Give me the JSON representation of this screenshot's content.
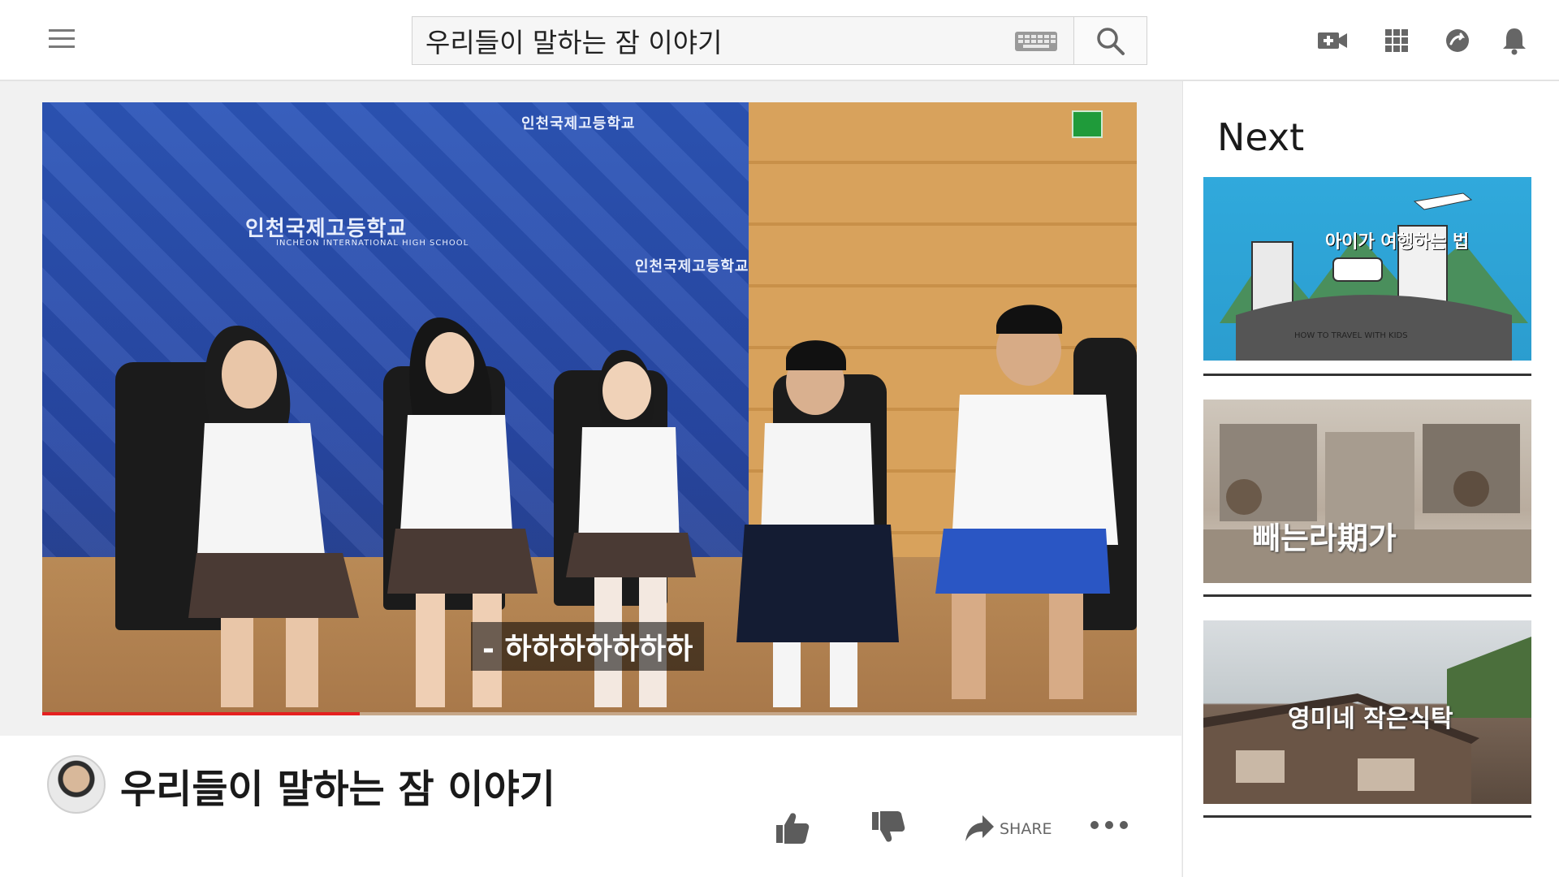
{
  "search": {
    "value": "우리들이 말하는 잠 이야기"
  },
  "header": {
    "icons": [
      "menu-icon",
      "keyboard-icon",
      "search-icon",
      "create-video-icon",
      "apps-grid-icon",
      "messages-icon",
      "notifications-bell-icon"
    ]
  },
  "player": {
    "subtitle": "- 하하하하하하하",
    "wall_text_1": "인천국제고등학교",
    "wall_sub_1": "INCHEON INTERNATIONAL HIGH SCHOOL",
    "wall_text_2": "인천국제고등학교",
    "wall_text_3": "인천국제고등학교",
    "progress_fraction": 0.29,
    "progress_color": "#e52020"
  },
  "video": {
    "title": "우리들이 말하는 잠 이야기",
    "share_label": "SHARE"
  },
  "sidebar": {
    "next_label": "Next",
    "thumbnails": [
      {
        "text": "아이가 여행하는 법",
        "sub": "HOW TO TRAVEL WITH KIDS"
      },
      {
        "text": "빼는라期가"
      },
      {
        "text": "영미네 작은식탁"
      }
    ]
  },
  "colors": {
    "accent": "#e52020",
    "topbar_bg": "#ffffff",
    "page_bg": "#f1f1f1"
  }
}
